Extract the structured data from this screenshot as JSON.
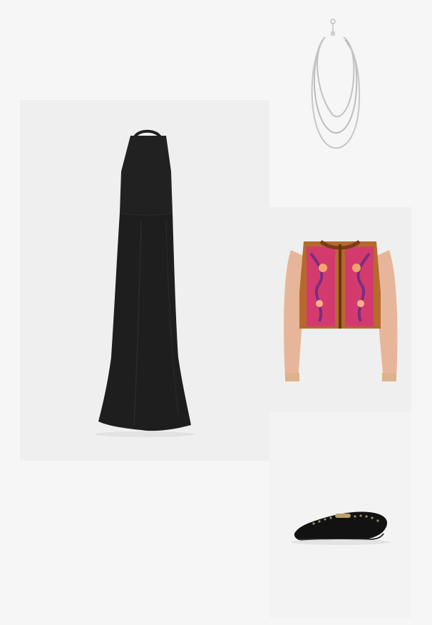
{
  "outfit": {
    "items": [
      {
        "icon": "halter-maxi-dress-image",
        "color": "#1f1e1e"
      },
      {
        "icon": "layered-chain-necklace-image",
        "color": "#bfbfbf"
      },
      {
        "icon": "embroidered-cropped-jacket-image",
        "colors": [
          "#b56a2c",
          "#d8327a",
          "#7a2d7f",
          "#e7b69a"
        ]
      },
      {
        "icon": "studded-loafer-image",
        "color": "#121212"
      }
    ]
  }
}
